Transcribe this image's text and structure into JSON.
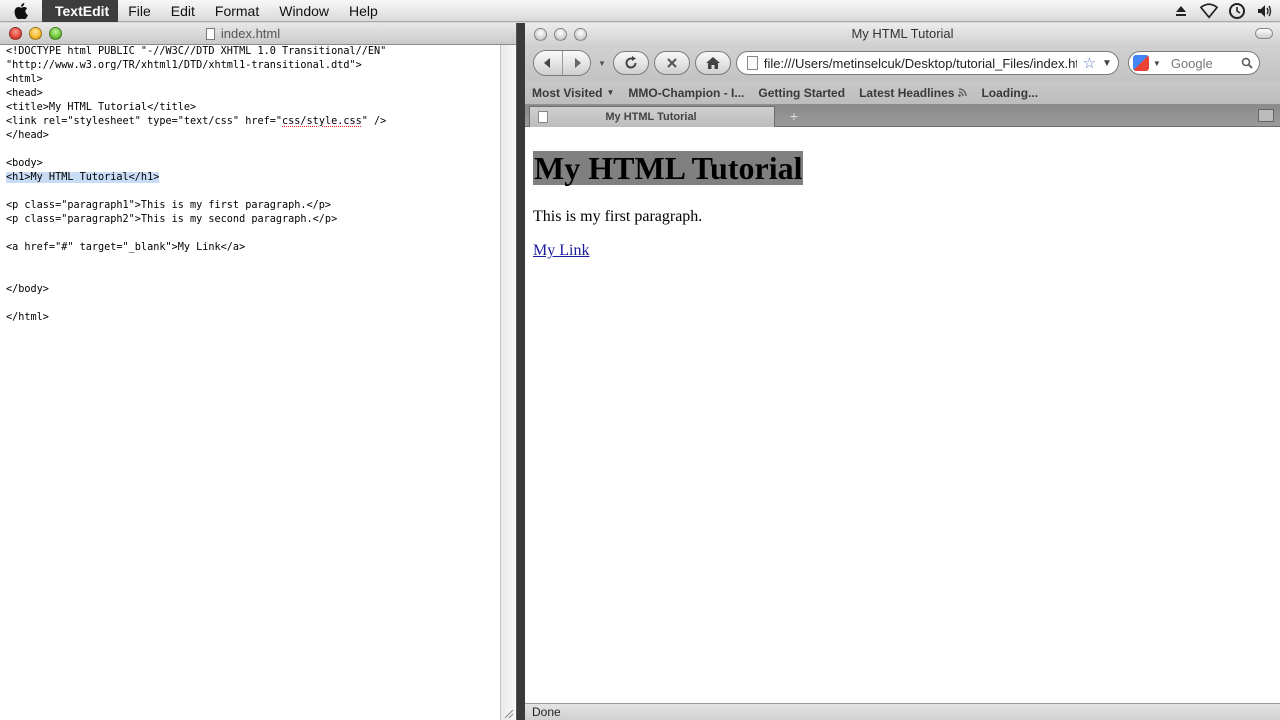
{
  "menubar": {
    "app_name": "TextEdit",
    "items": [
      "File",
      "Edit",
      "Format",
      "Window",
      "Help"
    ],
    "status_icons": [
      "eject-icon",
      "wifi-icon",
      "time-machine-icon",
      "volume-icon"
    ]
  },
  "textedit": {
    "window_title": "index.html",
    "lines": [
      "<!DOCTYPE html PUBLIC \"-//W3C//DTD XHTML 1.0 Transitional//EN\"",
      "\"http://www.w3.org/TR/xhtml1/DTD/xhtml1-transitional.dtd\">",
      "<html>",
      "<head>",
      "<title>My HTML Tutorial</title>",
      "<link rel=\"stylesheet\" type=\"text/css\" href=\"css/style.css\" />",
      "</head>",
      "",
      "<body>",
      "<h1>My HTML Tutorial</h1>",
      "",
      "<p class=\"paragraph1\">This is my first paragraph.</p>",
      "<p class=\"paragraph2\">This is my second paragraph.</p>",
      "",
      "<a href=\"#\" target=\"_blank\">My Link</a>",
      "",
      "",
      "</body>",
      "",
      "</html>"
    ],
    "selected_line_index": 9
  },
  "browser": {
    "window_title": "My HTML Tutorial",
    "url": "file:///Users/metinselcuk/Desktop/tutorial_Files/index.html",
    "search_placeholder": "Google",
    "bookmarks": [
      "Most Visited",
      "MMO-Champion - I...",
      "Getting Started",
      "Latest Headlines",
      "Loading..."
    ],
    "tab_title": "My HTML Tutorial",
    "page": {
      "heading": "My HTML Tutorial",
      "paragraph": "This is my first paragraph.",
      "link": "My Link",
      "heading_bg": "#808080"
    },
    "status": "Done"
  }
}
